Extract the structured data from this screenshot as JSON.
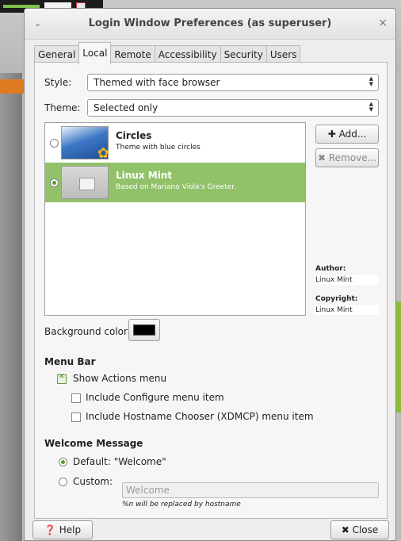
{
  "window": {
    "title": "Login Window Preferences (as superuser)",
    "menu_glyph": "⌄",
    "close_glyph": "×"
  },
  "tabs": [
    "General",
    "Local",
    "Remote",
    "Accessibility",
    "Security",
    "Users"
  ],
  "local": {
    "style_label": "Style:",
    "style_value": "Themed with face browser",
    "theme_label": "Theme:",
    "theme_value": "Selected only",
    "themes": [
      {
        "name": "Circles",
        "description": "Theme with blue circles",
        "selected": false
      },
      {
        "name": "Linux Mint",
        "description": "Based on Mariano Viola's Greeter.",
        "selected": true
      }
    ],
    "add_button": "Add...",
    "remove_button": "Remove...",
    "author_label": "Author:",
    "author_value": "Linux Mint",
    "copyright_label": "Copyright:",
    "copyright_value": "Linux Mint",
    "background_color_label": "Background color:",
    "background_color": "#000000"
  },
  "menu_bar": {
    "heading": "Menu Bar",
    "show_actions": "Show Actions menu",
    "include_configure": "Include Configure menu item",
    "include_hostname": "Include Hostname Chooser (XDMCP) menu item"
  },
  "welcome": {
    "heading": "Welcome Message",
    "default_label": "Default: \"Welcome\"",
    "custom_label": "Custom:",
    "custom_placeholder": "Welcome",
    "hint": "%n will be replaced by hostname"
  },
  "footer": {
    "help_button": "Help",
    "close_button": "Close"
  },
  "colors": {
    "selection_green": "#91c26a",
    "accent_green": "#5a9a2a"
  }
}
